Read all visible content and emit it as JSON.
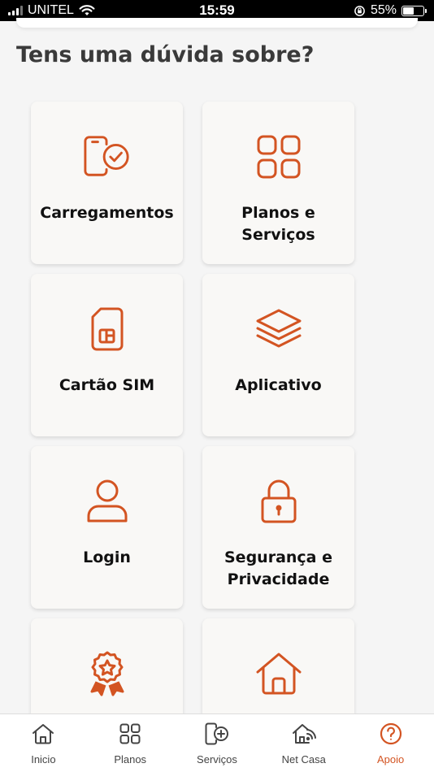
{
  "status_bar": {
    "carrier": "UNITEL",
    "time": "15:59",
    "battery": "55%",
    "battery_level": 0.55
  },
  "page": {
    "section_title": "Tens uma dúvida sobre?"
  },
  "colors": {
    "accent": "#d35422",
    "card_bg": "#f9f8f6"
  },
  "categories": [
    {
      "label": "Carregamentos",
      "icon": "phone-check-icon"
    },
    {
      "label": "Planos e Serviços",
      "icon": "grid-icon"
    },
    {
      "label": "Cartão SIM",
      "icon": "sim-card-icon"
    },
    {
      "label": "Aplicativo",
      "icon": "layers-icon"
    },
    {
      "label": "Login",
      "icon": "user-icon"
    },
    {
      "label": "Segurança e Privacidade",
      "icon": "lock-icon"
    },
    {
      "label": "",
      "icon": "award-icon"
    },
    {
      "label": "",
      "icon": "home-icon"
    }
  ],
  "bottom_nav": {
    "items": [
      {
        "label": "Inicio",
        "icon": "home-icon"
      },
      {
        "label": "Planos",
        "icon": "grid-icon"
      },
      {
        "label": "Serviços",
        "icon": "phone-plus-icon"
      },
      {
        "label": "Net Casa",
        "icon": "home-wifi-icon"
      },
      {
        "label": "Apoio",
        "icon": "help-icon",
        "active": true
      }
    ]
  }
}
